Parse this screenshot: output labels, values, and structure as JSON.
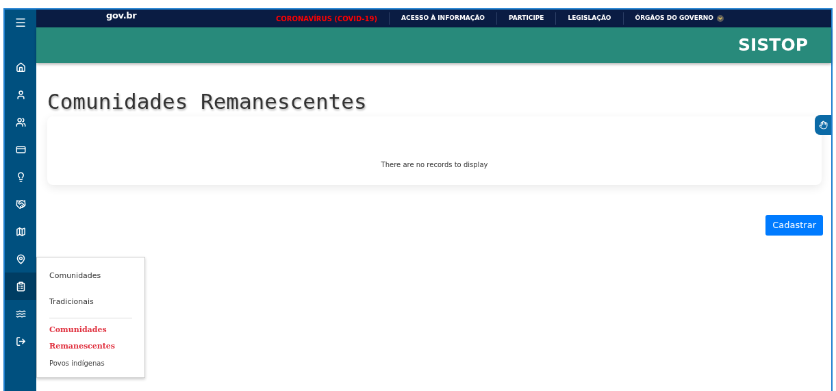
{
  "top_bar": {
    "logo": "gov.br",
    "links": [
      {
        "label": "CORONAVÍRUS (COVID-19)",
        "kind": "alert",
        "has_dropdown": false
      },
      {
        "label": "ACESSO À INFORMAÇÃO",
        "kind": "link",
        "has_dropdown": false
      },
      {
        "label": "PARTICIPE",
        "kind": "link",
        "has_dropdown": false
      },
      {
        "label": "LEGISLAÇÃO",
        "kind": "link",
        "has_dropdown": false
      },
      {
        "label": "ÓRGÃOS DO GOVERNO",
        "kind": "link",
        "has_dropdown": true
      }
    ]
  },
  "header": {
    "app_name": "SISTOP"
  },
  "sidebar": {
    "items": [
      {
        "selected": false
      },
      {
        "selected": false
      },
      {
        "selected": false
      },
      {
        "selected": false
      },
      {
        "selected": false
      },
      {
        "selected": false
      },
      {
        "selected": false
      },
      {
        "selected": false
      },
      {
        "selected": true
      },
      {
        "selected": false
      },
      {
        "selected": false
      }
    ]
  },
  "flyout_menu": {
    "items": [
      {
        "label": "Comunidades Tradicionais",
        "selected": false,
        "divider_after": true
      },
      {
        "label": "Comunidades Remanescentes",
        "selected": true,
        "divider_after": false
      },
      {
        "label": "Povos indígenas",
        "selected": false,
        "divider_after": false
      }
    ]
  },
  "page": {
    "title": "Comunidades Remanescentes",
    "table": {
      "empty_message": "There are no records to display"
    },
    "primary_button": "Cadastrar"
  }
}
